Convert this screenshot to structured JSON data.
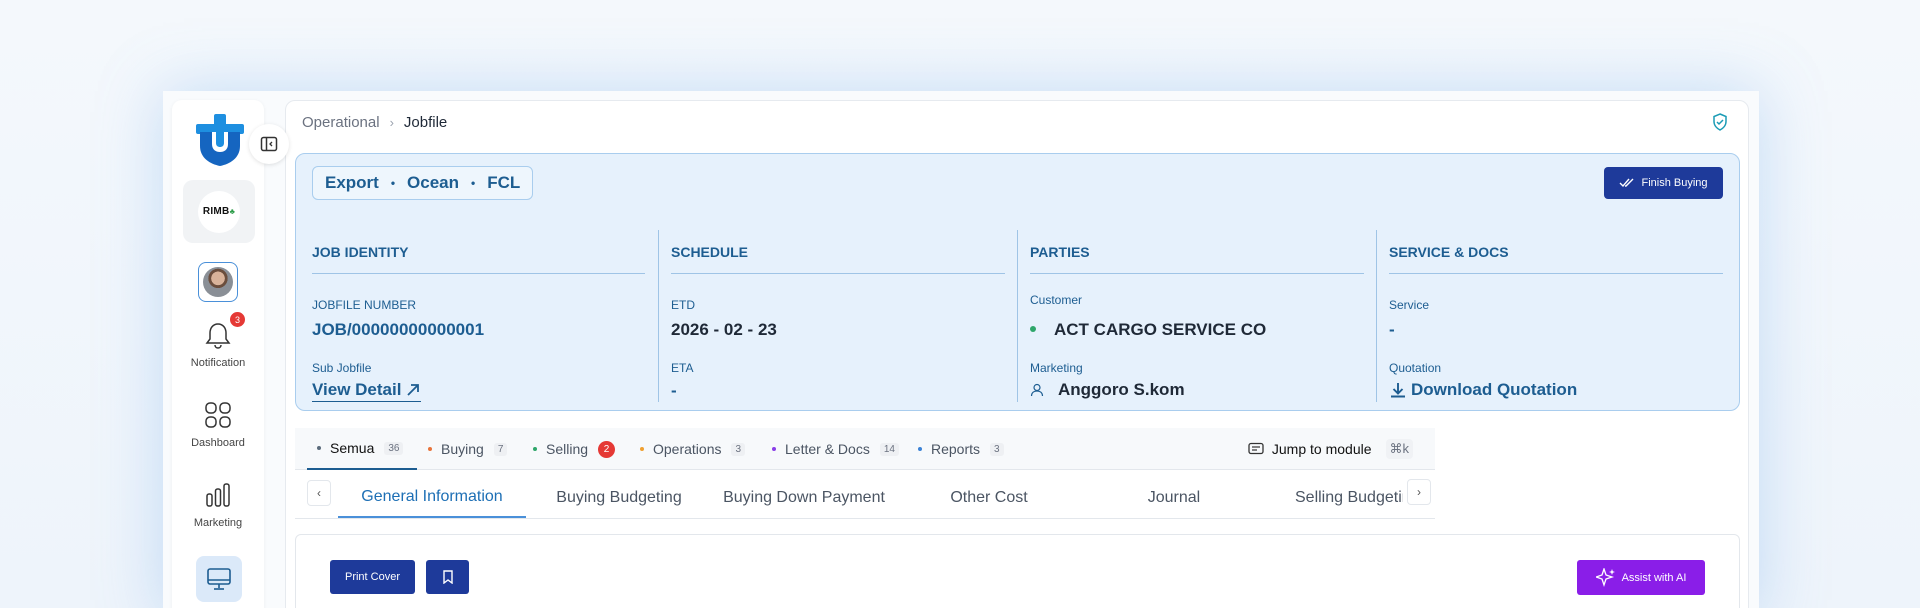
{
  "breadcrumb": {
    "parent": "Operational",
    "separator": "›",
    "current": "Jobfile"
  },
  "sidebar": {
    "brand": "RIMB",
    "notification": {
      "label": "Notification",
      "badge": "3",
      "icon": "bell-icon"
    },
    "items": [
      {
        "label": "Dashboard",
        "icon": "grid-icon"
      },
      {
        "label": "Marketing",
        "icon": "bar-chart-icon"
      }
    ],
    "active_icon": "monitor-icon"
  },
  "job": {
    "mode": [
      "Export",
      "Ocean",
      "FCL"
    ],
    "mode_sep": "•",
    "finish_button": "Finish Buying",
    "sections": {
      "identity": {
        "title": "JOB IDENTITY",
        "jobfile_label": "JOBFILE NUMBER",
        "jobfile_value": "JOB/00000000000001",
        "sub_label": "Sub Jobfile",
        "sub_link": "View Detail"
      },
      "schedule": {
        "title": "SCHEDULE",
        "etd_label": "ETD",
        "etd_value": "2026 - 02 - 23",
        "eta_label": "ETA",
        "eta_value": "-"
      },
      "parties": {
        "title": "PARTIES",
        "customer_label": "Customer",
        "customer_value": "ACT CARGO SERVICE CO",
        "marketing_label": "Marketing",
        "marketing_value": "Anggoro S.kom"
      },
      "service": {
        "title": "SERVICE & DOCS",
        "service_label": "Service",
        "service_value": "-",
        "quotation_label": "Quotation",
        "quotation_link": "Download Quotation"
      }
    }
  },
  "module_tabs": [
    {
      "label": "Semua",
      "count": "36",
      "color": "#5b6b7c"
    },
    {
      "label": "Buying",
      "count": "7",
      "color": "#e8743b"
    },
    {
      "label": "Selling",
      "count": "2",
      "color": "#2ea66a"
    },
    {
      "label": "Operations",
      "count": "3",
      "color": "#f0a030"
    },
    {
      "label": "Letter & Docs",
      "count": "14",
      "color": "#8a3ee8"
    },
    {
      "label": "Reports",
      "count": "3",
      "color": "#3b82d6"
    }
  ],
  "jump": {
    "label": "Jump to module",
    "shortcut": "⌘k"
  },
  "sub_tabs": [
    "General Information",
    "Buying Budgeting",
    "Buying Down Payment",
    "Other Cost",
    "Journal",
    "Selling Budgeting"
  ],
  "actions": {
    "print": "Print Cover",
    "ai": "Assist with AI"
  }
}
